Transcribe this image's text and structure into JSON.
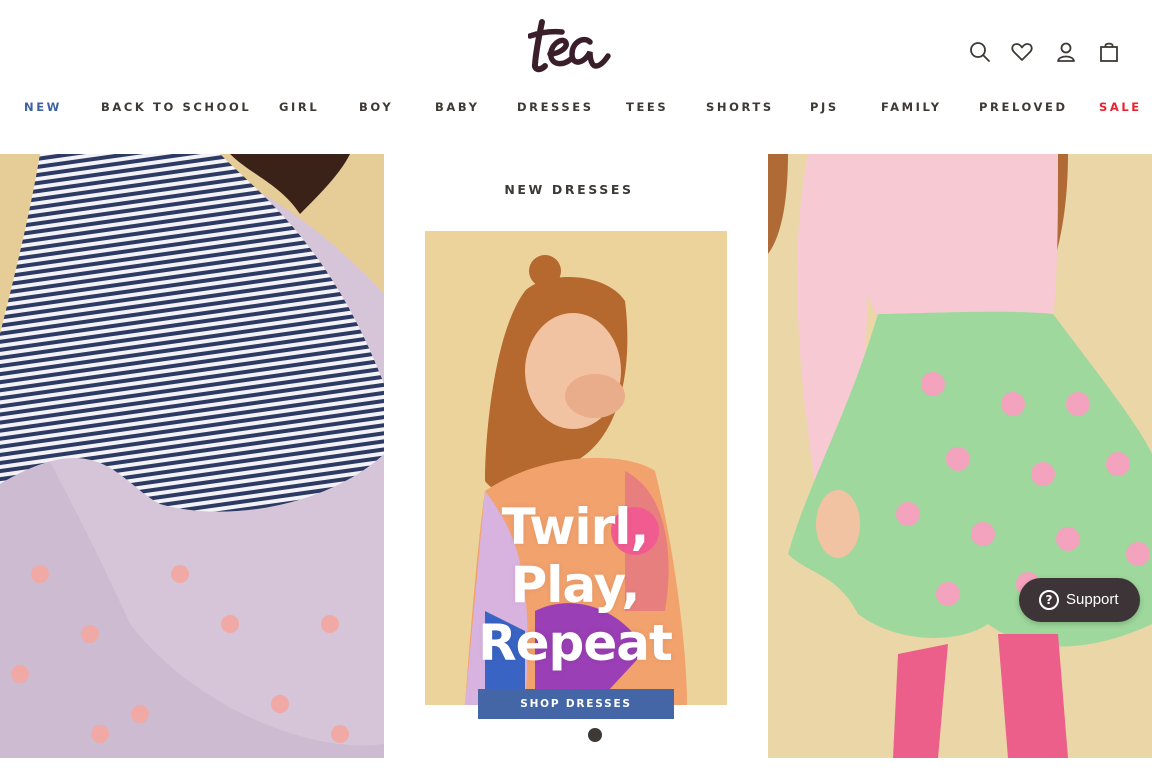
{
  "header": {
    "logo_text": "tea",
    "icons": [
      "search-icon",
      "heart-icon",
      "account-icon",
      "bag-icon"
    ]
  },
  "nav": {
    "items": [
      {
        "label": "NEW",
        "color": "#3f62a0"
      },
      {
        "label": "BACK TO SCHOOL"
      },
      {
        "label": "GIRL"
      },
      {
        "label": "BOY"
      },
      {
        "label": "BABY"
      },
      {
        "label": "DRESSES"
      },
      {
        "label": "TEES"
      },
      {
        "label": "SHORTS"
      },
      {
        "label": "PJS"
      },
      {
        "label": "FAMILY"
      },
      {
        "label": "PRELOVED"
      },
      {
        "label": "SALE",
        "color": "#e8232e"
      }
    ]
  },
  "promo": {
    "section_title": "NEW DRESSES",
    "headline": [
      "Twirl,",
      "Play,",
      "Repeat"
    ],
    "button_label": "SHOP DRESSES",
    "button_color": "#4566a6"
  },
  "support_widget": {
    "label": "Support",
    "icon": "question-circle-icon"
  },
  "colors": {
    "text": "#3d3935",
    "accent_blue": "#3f62a0",
    "sale_red": "#e8232e"
  }
}
